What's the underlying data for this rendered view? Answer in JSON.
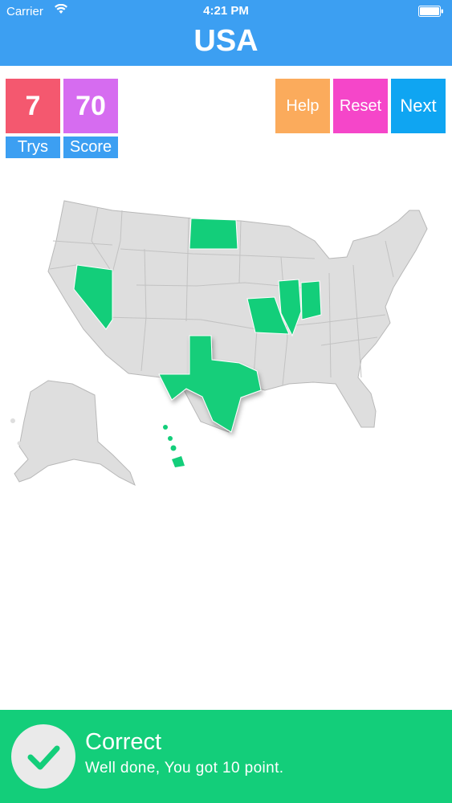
{
  "status_bar": {
    "carrier": "Carrier",
    "time": "4:21 PM"
  },
  "header": {
    "title": "USA"
  },
  "stats": {
    "trys_value": "7",
    "trys_label": "Trys",
    "score_value": "70",
    "score_label": "Score"
  },
  "buttons": {
    "help": "Help",
    "reset": "Reset",
    "next": "Next"
  },
  "map": {
    "correct_states": [
      "Nevada",
      "North Dakota",
      "Texas",
      "Missouri",
      "Illinois",
      "Indiana",
      "Hawaii"
    ],
    "land_color": "#dedede",
    "correct_color": "#13ce7a"
  },
  "footer": {
    "title": "Correct",
    "message": "Well done, You got 10 point."
  },
  "colors": {
    "header": "#3c9ff2",
    "trys": "#f4586f",
    "score": "#d66cf0",
    "help": "#fbab5c",
    "reset": "#f546c9",
    "next": "#0fa5f2",
    "footer": "#13ce7a"
  }
}
